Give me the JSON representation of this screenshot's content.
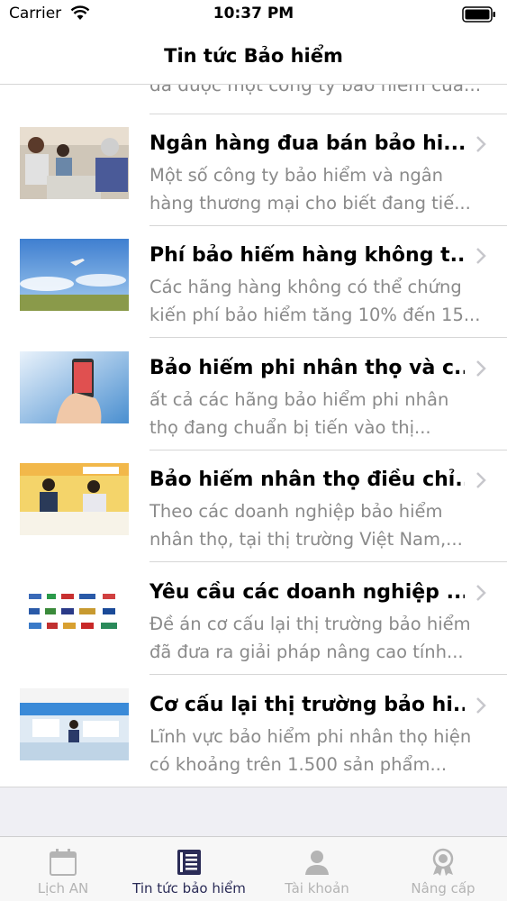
{
  "status_bar": {
    "carrier": "Carrier",
    "time": "10:37 PM"
  },
  "nav": {
    "title": "Tin tức Bảo hiểm"
  },
  "partial_item": {
    "desc": "đã được một công ty bảo hiểm của..."
  },
  "articles": [
    {
      "title": "Ngân hàng đua bán bảo hi...",
      "desc1": "Một số công ty bảo hiểm và ngân",
      "desc2": "hàng thương mại cho biết đang tiế..."
    },
    {
      "title": "Phí bảo hiểm hàng không t...",
      "desc1": "Các hãng hàng không có thể chứng",
      "desc2": "kiến phí bảo hiểm tăng 10% đến 15..."
    },
    {
      "title": "Bảo hiểm phi nhân thọ và c...",
      "desc1": "ất cả các hãng bảo hiểm phi nhân",
      "desc2": "thọ đang chuẩn bị tiến vào thị..."
    },
    {
      "title": "Bảo hiểm nhân thọ điều chỉ...",
      "desc1": "Theo các doanh nghiệp bảo hiểm",
      "desc2": "nhân thọ, tại thị trường Việt Nam,..."
    },
    {
      "title": "Yêu cầu các doanh nghiệp ...",
      "desc1": "Đề án cơ cấu lại thị trường bảo hiểm",
      "desc2": "đã đưa ra giải pháp nâng cao tính..."
    },
    {
      "title": "Cơ cấu lại thị trường bảo hi...",
      "desc1": "Lĩnh vực bảo hiểm phi nhân thọ hiện",
      "desc2": "có khoảng trên 1.500 sản phẩm..."
    }
  ],
  "tabs": [
    {
      "label": "Lịch AN",
      "icon": "calendar-icon",
      "active": false
    },
    {
      "label": "Tin tức bảo hiểm",
      "icon": "news-icon",
      "active": true
    },
    {
      "label": "Tài khoản",
      "icon": "person-icon",
      "active": false
    },
    {
      "label": "Nâng cấp",
      "icon": "award-icon",
      "active": false
    }
  ],
  "colors": {
    "accent": "#2b2c57",
    "inactive": "#b4b4b4",
    "secondary_text": "#8a8a8a"
  }
}
